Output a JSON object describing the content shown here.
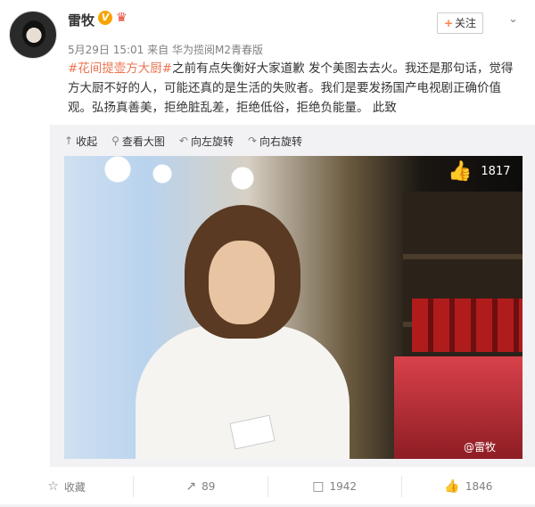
{
  "user": {
    "name": "雷牧",
    "verified_badge": "V",
    "vip_icon": "crown-icon"
  },
  "meta": {
    "date": "5月29日",
    "time": "15:01",
    "source_prefix": "来自",
    "source": "华为揽阅M2青春版"
  },
  "follow": {
    "plus": "+",
    "label": "关注"
  },
  "post": {
    "topic": "#花间提壶方大厨#",
    "text": "之前有点失衡好大家道歉 发个美图去去火。我还是那句话，觉得方大厨不好的人，可能还真的是生活的失败者。我们是要发扬国产电视剧正确价值观。弘扬真善美，拒绝脏乱差，拒绝低俗，拒绝负能量。    此致"
  },
  "media_toolbar": {
    "collapse": "收起",
    "view_large": "查看大图",
    "rotate_left": "向左旋转",
    "rotate_right": "向右旋转"
  },
  "photo": {
    "like_count": "1817",
    "watermark": "@雷牧"
  },
  "actions": {
    "favorite": "收藏",
    "repost": "89",
    "comment": "1942",
    "like": "1846"
  },
  "colors": {
    "topic": "#eb7350",
    "follow_plus": "#ff8140",
    "verified": "#f7a400"
  }
}
